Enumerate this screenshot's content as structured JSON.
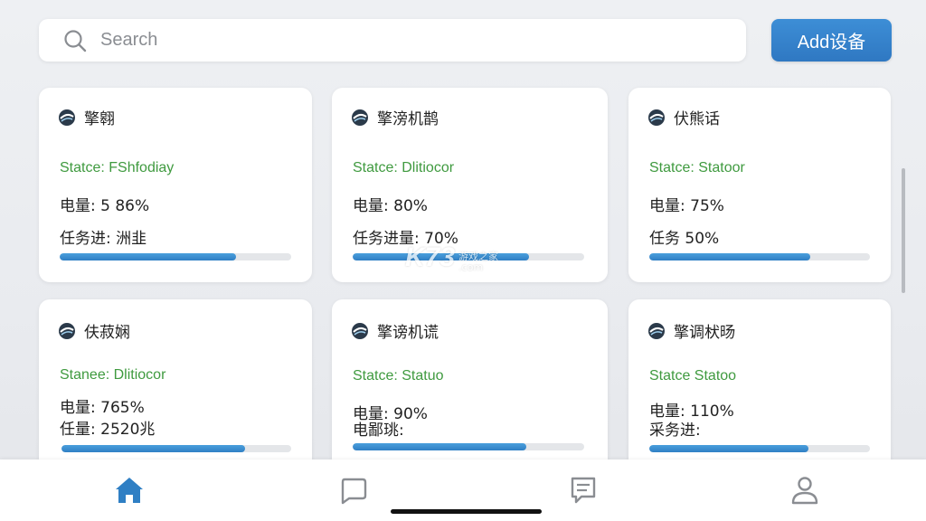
{
  "search": {
    "placeholder": "Search"
  },
  "add_button": {
    "label": "Add设备"
  },
  "cards": [
    {
      "name": "擎翱",
      "status": "Statce: FShfodiay",
      "line1": "电量: 5 86%",
      "line2": "任务进: 洲韭",
      "progress": 0.76
    },
    {
      "name": "擎滂机鹊",
      "status": "Statce: Dlitiocor",
      "line1": "电量: 80%",
      "line2": "任务进量: 70%",
      "progress": 0.76
    },
    {
      "name": "伏熊话",
      "status": "Statce: Statoor",
      "line1": "电量: 75%",
      "line2": "任务 50%",
      "progress": 0.73
    },
    {
      "name": "伕菽娴",
      "status": "Stanee: Dlitiocor",
      "line1": "电量: 765%",
      "line2": "任量: 2520兆",
      "progress": 0.8
    },
    {
      "name": "擎谤机谎",
      "status": "Statce: Statuo",
      "line1": "电量: 90%",
      "line2": "电鄙珧:",
      "progress": 0.75
    },
    {
      "name": "擎调枤旸",
      "status": "Statce Statoo",
      "line1": "电量: 110%",
      "line2": "采务进:",
      "progress": 0.72
    }
  ],
  "watermark": {
    "brand": "K73",
    "cn": "游戏之家",
    "domain": ".com"
  },
  "nav": [
    {
      "id": "home",
      "icon": "home-icon",
      "active": true
    },
    {
      "id": "chat",
      "icon": "chat-bubble-icon",
      "active": false
    },
    {
      "id": "messages",
      "icon": "message-list-icon",
      "active": false
    },
    {
      "id": "profile",
      "icon": "person-icon",
      "active": false
    }
  ],
  "colors": {
    "accent": "#2f7fc4",
    "status_green": "#3f9a3f",
    "inactive_icon": "#8a8d92"
  }
}
